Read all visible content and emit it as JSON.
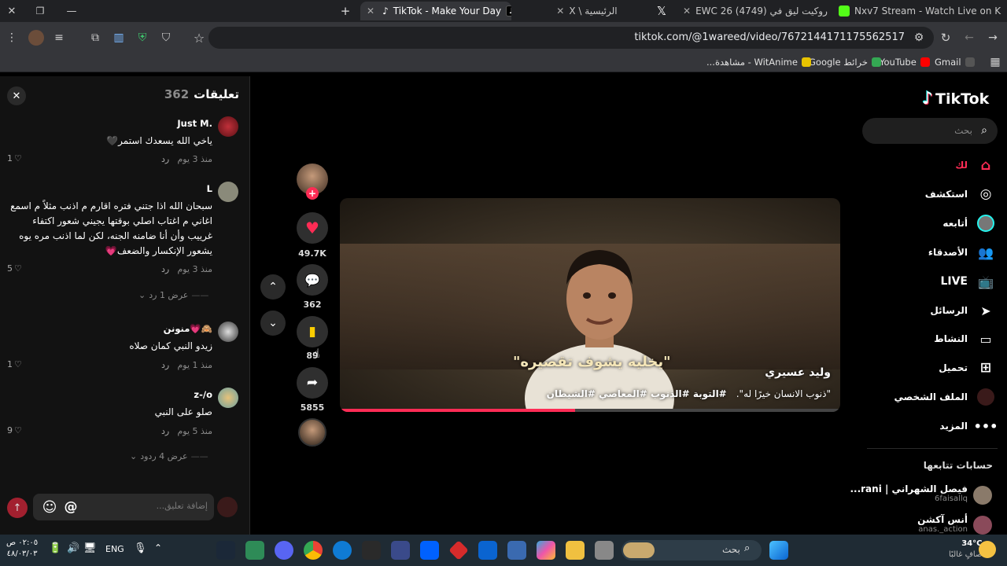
{
  "browser": {
    "tabs": [
      {
        "label": "Nxv7 Stream - Watch Live on K",
        "color": "#53fc18"
      },
      {
        "label": "EWC 26 روكيت ليق في (4749)",
        "color": "#ff0000"
      },
      {
        "label": "X \\ الرئيسية",
        "color": "#000000"
      },
      {
        "label": "TikTok - Make Your Day",
        "color": "#010101"
      }
    ],
    "url": "tiktok.com/@1wareed/video/7672144171175562517",
    "bookmarks": [
      "Gmail",
      "YouTube",
      "خرائط Google",
      "WitAnime - مشاهدة..."
    ]
  },
  "comments": {
    "title": "تعليقات",
    "count": "362",
    "items": [
      {
        "user": "Just M.",
        "text": "ياخي الله يسعدك استمر🖤",
        "time": "منذ 3 يوم",
        "reply": "رد",
        "likes": "1"
      },
      {
        "user": "L",
        "text": "سبحان الله اذا جتني فتره اقارم م اذنب مثلاً م اسمع اغاني م اغتاب اصلي بوقتها يجيني شعور اكتفاء غرييب وأن أنا ضامنه الجنه، لكن لما اذنب مره يوه يشعور الإنكسار والضعف💗",
        "time": "منذ 3 يوم",
        "reply": "رد",
        "likes": "5",
        "more": "عرض 1 رد"
      },
      {
        "user": "منونن💗🙈",
        "text": "زيدو النبي كمان صلاه",
        "time": "منذ 1 يوم",
        "reply": "رد",
        "likes": "1"
      },
      {
        "user": "z-/o",
        "text": "صلو على النبي",
        "time": "منذ 5 يوم",
        "reply": "رد",
        "likes": "9",
        "more": "عرض 4 ردود"
      }
    ],
    "input_placeholder": "إضافة تعليق..."
  },
  "video": {
    "author": "وليد عسيري",
    "caption": "\"ذنوب الانسان خيرًا له\".",
    "hashtags": "#التوبة #الذنوب #المعاصي #الشيطان",
    "overlay_text": "\"يخليه يشوف تقصيره\"",
    "progress": 0.47
  },
  "actions": {
    "likes": "49.7K",
    "comments": "362",
    "saves": "89",
    "shares": "5855"
  },
  "nav": {
    "logo": "TikTok",
    "search_placeholder": "بحث",
    "items": [
      {
        "label": "لك",
        "icon": "home-icon",
        "active": true
      },
      {
        "label": "استكشف",
        "icon": "compass-icon"
      },
      {
        "label": "أتابعه",
        "icon": "following-avatar-icon"
      },
      {
        "label": "الأصدقاء",
        "icon": "friends-icon"
      },
      {
        "label": "LIVE",
        "icon": "live-icon"
      },
      {
        "label": "الرسائل",
        "icon": "send-icon"
      },
      {
        "label": "النشاط",
        "icon": "activity-icon"
      },
      {
        "label": "تحميل",
        "icon": "upload-icon"
      },
      {
        "label": "الملف الشخصي",
        "icon": "profile-icon"
      },
      {
        "label": "المزيد",
        "icon": "more-icon"
      }
    ],
    "following_title": "حسابات تتابعها",
    "following": [
      {
        "name": "فيصل الشهراني | rani...",
        "handle": "6faisallq"
      },
      {
        "name": "أنس آكشن",
        "handle": "anas._action"
      }
    ]
  },
  "taskbar": {
    "search": "بحث",
    "lang": "ENG",
    "time": "٠٢:٠٥ ص",
    "date": "٤٨/٠٣/٠٣",
    "weather_temp": "34°C",
    "weather_desc": "صافٍ غالبًا"
  }
}
